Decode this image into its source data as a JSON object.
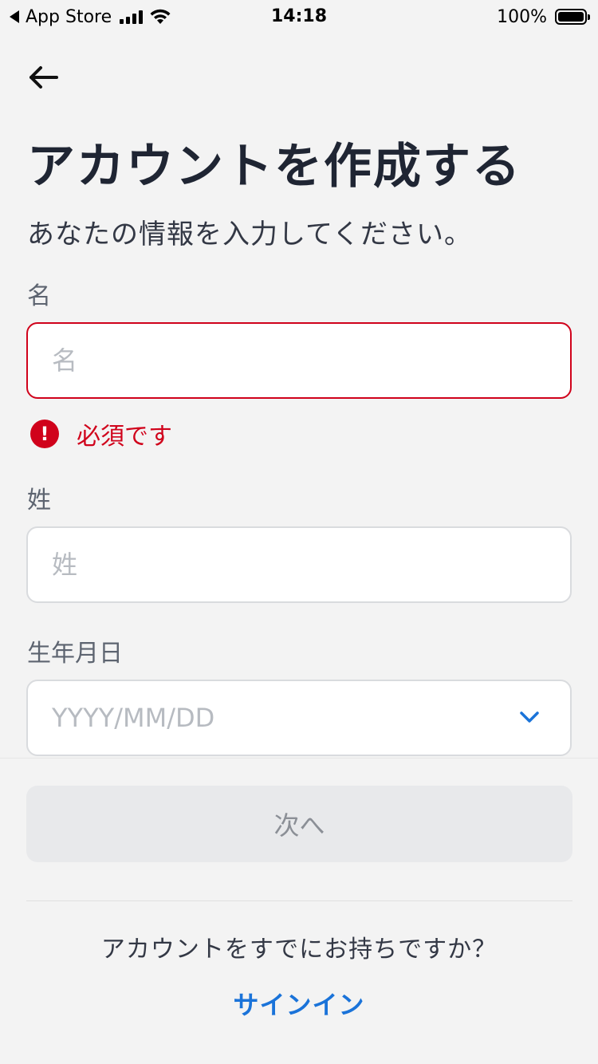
{
  "status_bar": {
    "carrier": "App Store",
    "time": "14:18",
    "battery": "100%",
    "battery_level": 1.0
  },
  "header": {
    "back_icon": "arrow-left-icon",
    "title": "アカウントを作成する",
    "subtitle": "あなたの情報を入力してください。"
  },
  "form": {
    "first_name": {
      "label": "名",
      "placeholder": "名",
      "value": "",
      "error": "必須です"
    },
    "last_name": {
      "label": "姓",
      "placeholder": "姓",
      "value": ""
    },
    "birthdate": {
      "label": "生年月日",
      "placeholder": "YYYY/MM/DD",
      "icon": "chevron-down-icon"
    }
  },
  "footer": {
    "next_label": "次へ",
    "have_account_text": "アカウントをすでにお持ちですか？",
    "signin_label": "サインイン"
  },
  "colors": {
    "error": "#d0021b",
    "link": "#1a73d9",
    "title": "#1f2533",
    "background": "#f3f3f3"
  }
}
